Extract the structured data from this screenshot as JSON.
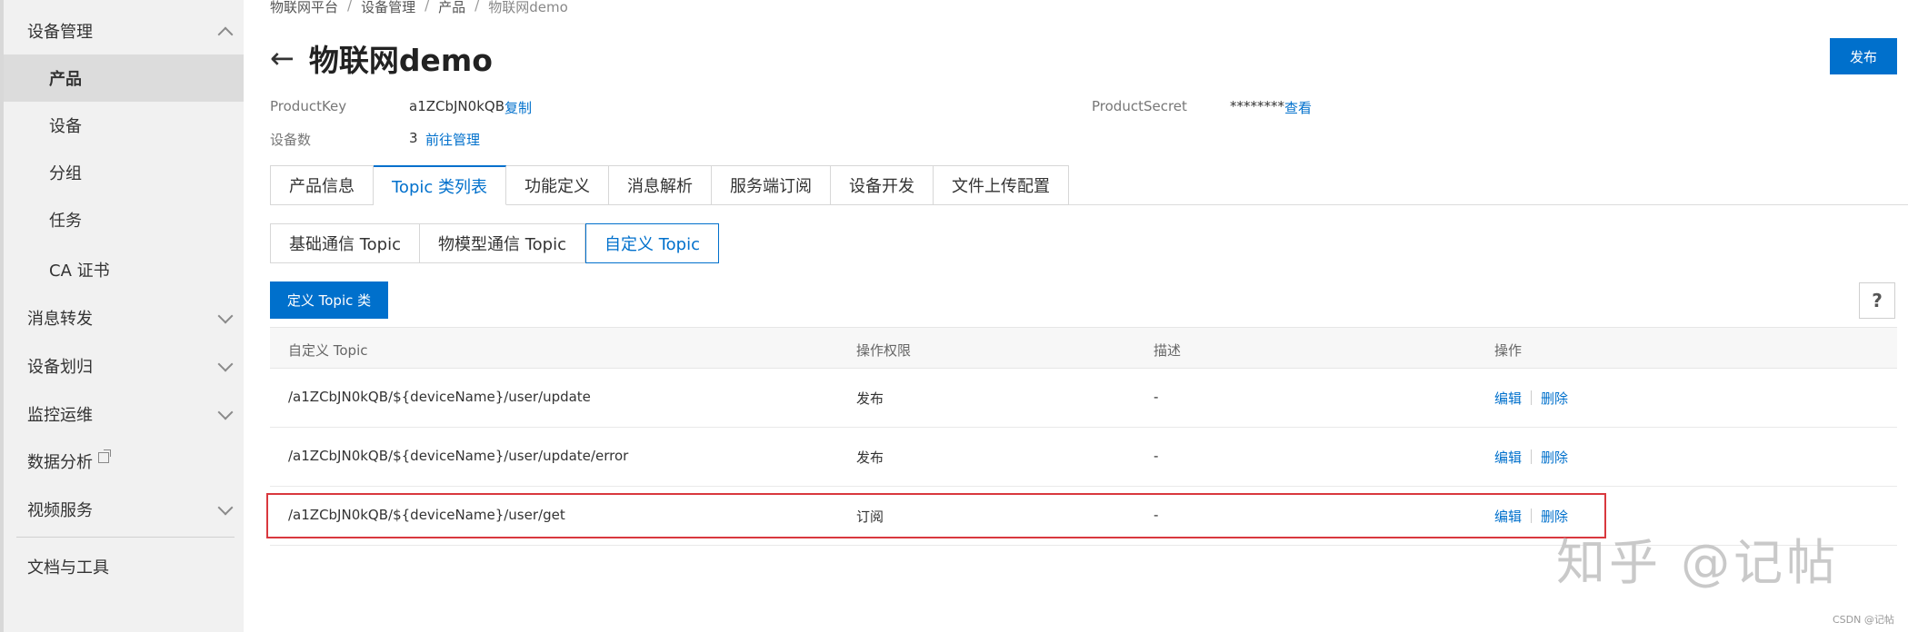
{
  "sidebar": {
    "groups": [
      {
        "label": "设备管理",
        "expanded": true
      },
      {
        "label": "消息转发",
        "expanded": false
      },
      {
        "label": "设备划归",
        "expanded": false
      },
      {
        "label": "监控运维",
        "expanded": false
      },
      {
        "label": "数据分析",
        "external": true
      },
      {
        "label": "视频服务",
        "expanded": false
      },
      {
        "label": "文档与工具"
      }
    ],
    "items": [
      {
        "label": "产品",
        "active": true
      },
      {
        "label": "设备"
      },
      {
        "label": "分组"
      },
      {
        "label": "任务"
      },
      {
        "label": "CA 证书"
      }
    ]
  },
  "breadcrumb": [
    "物联网平台",
    "设备管理",
    "产品",
    "物联网demo"
  ],
  "breadcrumb_sep": "/",
  "header": {
    "back_icon": "←",
    "title": "物联网demo",
    "publish_label": "发布"
  },
  "meta": {
    "product_key_label": "ProductKey",
    "product_key_value": "a1ZCbJN0kQB",
    "copy_label": "复制",
    "product_secret_label": "ProductSecret",
    "product_secret_value": "********",
    "view_label": "查看",
    "device_count_label": "设备数",
    "device_count_value": "3",
    "manage_label": "前往管理"
  },
  "tabs": [
    {
      "label": "产品信息"
    },
    {
      "label": "Topic 类列表",
      "active": true
    },
    {
      "label": "功能定义"
    },
    {
      "label": "消息解析"
    },
    {
      "label": "服务端订阅"
    },
    {
      "label": "设备开发"
    },
    {
      "label": "文件上传配置"
    }
  ],
  "subtabs": [
    {
      "label": "基础通信 Topic"
    },
    {
      "label": "物模型通信 Topic"
    },
    {
      "label": "自定义 Topic",
      "active": true
    }
  ],
  "define_button_label": "定义 Topic 类",
  "help_label": "?",
  "table": {
    "columns": [
      "自定义 Topic",
      "操作权限",
      "描述",
      "操作"
    ],
    "rows": [
      {
        "topic": "/a1ZCbJN0kQB/${deviceName}/user/update",
        "permission": "发布",
        "desc": "-",
        "edit": "编辑",
        "delete": "删除"
      },
      {
        "topic": "/a1ZCbJN0kQB/${deviceName}/user/update/error",
        "permission": "发布",
        "desc": "-",
        "edit": "编辑",
        "delete": "删除"
      },
      {
        "topic": "/a1ZCbJN0kQB/${deviceName}/user/get",
        "permission": "订阅",
        "desc": "-",
        "edit": "编辑",
        "delete": "删除",
        "highlighted": true
      }
    ]
  },
  "watermark": "知乎 @记帖",
  "csdn_mark": "CSDN @记帖",
  "colors": {
    "accent": "#0070cc",
    "highlight": "#d9383e",
    "sidebar_bg": "#f1f1f1"
  }
}
